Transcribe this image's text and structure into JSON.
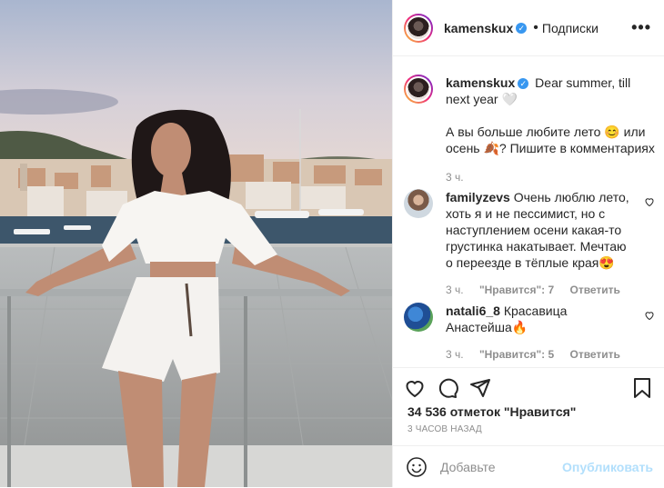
{
  "post": {
    "username": "kamenskux",
    "follow_label": "Подписки",
    "more_label": "•••"
  },
  "caption": {
    "username": "kamenskux",
    "text1": "Dear summer, till next year 🤍",
    "text2": "А вы больше любите лето 😊 или осень 🍂? Пишите в комментариях",
    "time": "3 ч."
  },
  "comments": [
    {
      "username": "familyzevs",
      "text": "Очень люблю лето, хоть я и не пессимист, но с наступлением осени какая-то грустинка накатывает. Мечтаю о переезде в тёплые края😍",
      "time": "3 ч.",
      "likes": "\"Нравится\": 7",
      "reply": "Ответить"
    },
    {
      "username": "natali6_8",
      "text": "Красавица Анастейша🔥",
      "time": "3 ч.",
      "likes": "\"Нравится\": 5",
      "reply": "Ответить"
    }
  ],
  "footer": {
    "likes": "34 536 отметок \"Нравится\"",
    "time_ago": "3 ЧАСОВ НАЗАД",
    "comment_placeholder": "Добавьте",
    "publish_label": "Опубликовать"
  }
}
